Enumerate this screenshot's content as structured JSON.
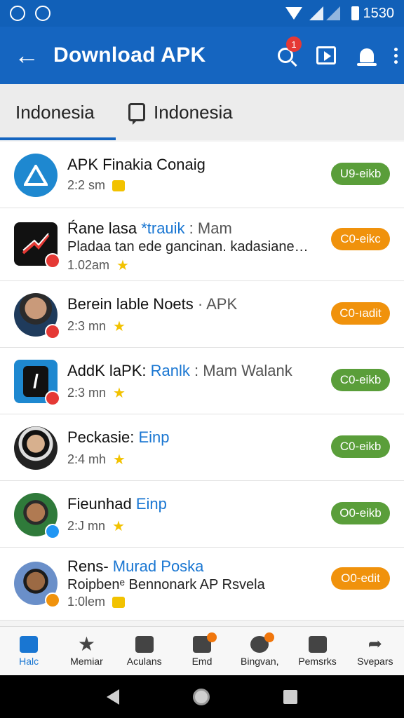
{
  "status_bar": {
    "time": "1530"
  },
  "app_bar": {
    "title": "Download APK",
    "notification_count": "1"
  },
  "tabs": [
    {
      "label": "Indonesia"
    },
    {
      "label": "Indonesia"
    }
  ],
  "items": [
    {
      "name": "APK  Finakia Conaig",
      "time": "2:2 sm",
      "button": "U9-eikb"
    },
    {
      "name_a": "Ŕane lasa ",
      "name_b": "*trauik",
      "name_c": " : Mam",
      "desc": "Pladaa tan ede gancinan. kadasiane…",
      "time": "1.02am",
      "button": "C0-eikc"
    },
    {
      "name_a": "Berein lable Noets",
      "name_c": " · APK",
      "time": "2:3 mn",
      "button": "C0-ıadit"
    },
    {
      "name_a": "AddK laPK: ",
      "name_b": "Ranlk",
      "name_c": " : Mam Walank",
      "time": "2:3 mn",
      "button": "C0-eikb"
    },
    {
      "name_a": "Peckasie: ",
      "name_b": "Einp",
      "time": "2:4 mh",
      "button": "C0-eikb"
    },
    {
      "name_a": "Fieunhad ",
      "name_b": "Einp",
      "time": "2:J mn",
      "button": "O0-eikb"
    },
    {
      "name_a": "Rens- ",
      "name_b": "Murad Poska",
      "desc": "Roipbenᵉ Bennonark AP Rsvela",
      "time": "1:0lem",
      "button": "O0-edit"
    }
  ],
  "bottom_nav": [
    {
      "label": "Halc"
    },
    {
      "label": "Memiar"
    },
    {
      "label": "Aculans"
    },
    {
      "label": "Emd"
    },
    {
      "label": "Bingvan,"
    },
    {
      "label": "Pemsrks"
    },
    {
      "label": "Svepars"
    }
  ],
  "colors": {
    "app_bar": "#1565c0",
    "green_button": "#5a9e3a",
    "orange_button": "#f0920c",
    "accent": "#1976d2"
  },
  "icons": [
    "back-arrow-icon",
    "search-icon",
    "play-icon",
    "bell-icon",
    "more-vert-icon"
  ]
}
